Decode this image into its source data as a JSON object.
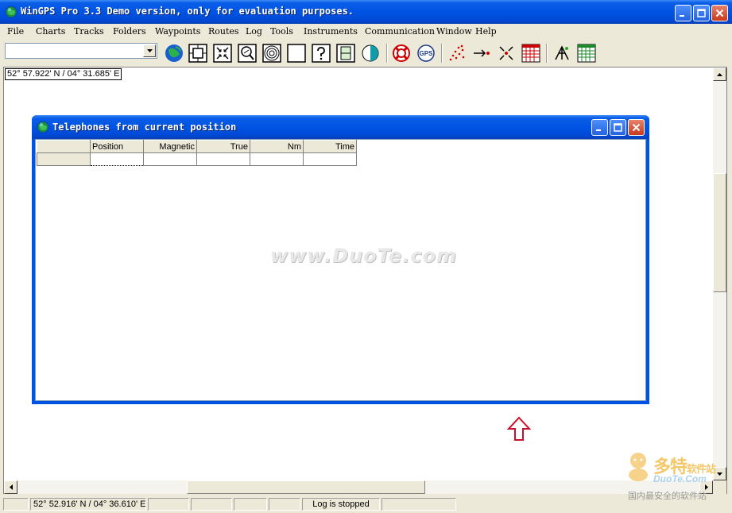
{
  "window": {
    "title": "WinGPS Pro 3.3 Demo version, only for evaluation purposes."
  },
  "menu": [
    "File",
    "Charts",
    "Tracks",
    "Folders",
    "Waypoints",
    "Routes",
    "Log",
    "Tools",
    "Instruments",
    "Communication",
    "Window",
    "Help"
  ],
  "toolbar": {
    "combo_value": "",
    "icons": [
      "globe-icon",
      "chart-frame-icon",
      "zoom-fit-icon",
      "zoom-icon",
      "radar-icon",
      "blank-chart-icon",
      "help-icon",
      "chart-list-icon",
      "day-night-icon",
      "lifebuoy-icon",
      "gps-icon",
      "waypoints-icon",
      "goto-icon",
      "collapse-icon",
      "table-icon",
      "compass-rose-icon",
      "grid-table-icon"
    ]
  },
  "position_readout": "52° 57.922' N / 04° 31.685' E",
  "child_window": {
    "title": "Telephones from current position",
    "columns": [
      "Position",
      "Magnetic",
      "True",
      "Nm",
      "Time"
    ],
    "rows": [
      [
        "",
        "",
        "",
        "",
        ""
      ]
    ]
  },
  "watermark": "www.DuoTe.com",
  "status_bar": {
    "cursor_position": "52° 52.916' N / 04° 36.610' E",
    "panel_2": "",
    "panel_3": "",
    "panel_4": "",
    "panel_5": "",
    "log_status": "Log is stopped",
    "panel_7": ""
  },
  "logo": {
    "cn_name": "多特",
    "cn_suffix": "软件站",
    "en_name": "DuoTe.Com",
    "tagline": "国内最安全的软件站"
  }
}
